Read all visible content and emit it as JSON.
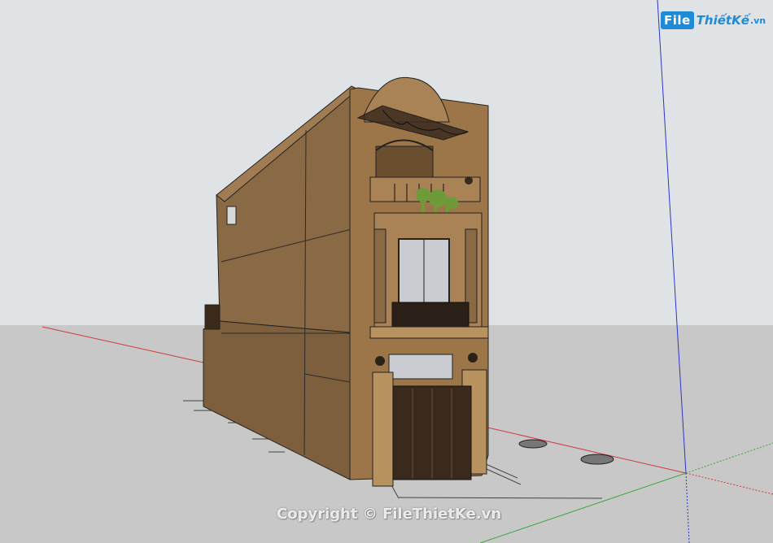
{
  "viewport": {
    "sky_color": "#dfe3e6",
    "ground_color": "#c8c8c8",
    "axis_colors": {
      "red": "#d23a3a",
      "green": "#3aa83a",
      "blue": "#2a36c8"
    },
    "wall_color": "#8a6a45",
    "trim_color": "#b8925f"
  },
  "logo": {
    "prefix": "File",
    "name": "ThiếtKế",
    "tld": ".vn"
  },
  "watermark": {
    "text": "Copyright © FileThietKe.vn"
  }
}
